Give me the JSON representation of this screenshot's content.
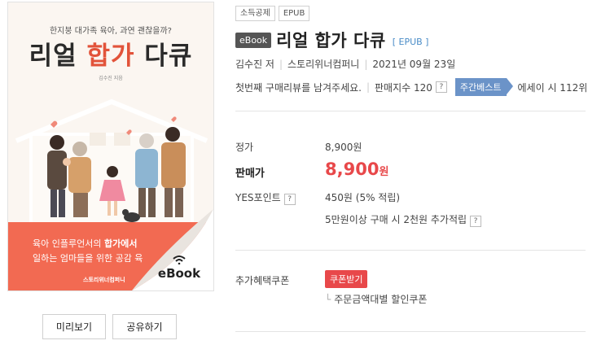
{
  "cover": {
    "tagline": "한지붕 대가족 육아, 과연 괜찮을까?",
    "title_part1": "리얼 ",
    "title_accent": "합가",
    "title_part2": " 다큐",
    "author": "김수진 지음",
    "promo_line1_a": "육아 인플루언서의 ",
    "promo_line1_b": "합가에서",
    "promo_line2": "일하는 엄마들을 위한 공감 육",
    "publisher": "스토리위너컴퍼니",
    "ebook_label": "eBook"
  },
  "buttons": {
    "preview": "미리보기",
    "share": "공유하기"
  },
  "tags": [
    "소득공제",
    "EPUB"
  ],
  "product": {
    "type_badge": "eBook",
    "title": "리얼 합가 다큐",
    "format": "[ EPUB ]",
    "author": "김수진 저",
    "publisher": "스토리위너컴퍼니",
    "date": "2021년 09월 23일",
    "review_prompt": "첫번째 구매리뷰를 남겨주세요.",
    "sales_index_label": "판매지수 120",
    "help": "?",
    "best_label": "주간베스트",
    "rank_text": "에세이 시 112위"
  },
  "pricing": {
    "list_label": "정가",
    "list_price": "8,900원",
    "sale_label": "판매가",
    "sale_price": "8,900",
    "sale_unit": "원",
    "points_label": "YES포인트",
    "points_value": "450원 (5% 적립)",
    "extra_points": "5만원이상 구매 시 2천원 추가적립"
  },
  "coupon": {
    "label": "추가혜택쿠폰",
    "button": "쿠폰받기",
    "sub": "주문금액대별 할인쿠폰"
  },
  "colors": {
    "accent_red": "#e8484a",
    "cover_orange": "#f26a52",
    "best_blue": "#6b93c8",
    "format_blue": "#4a8cc7"
  }
}
